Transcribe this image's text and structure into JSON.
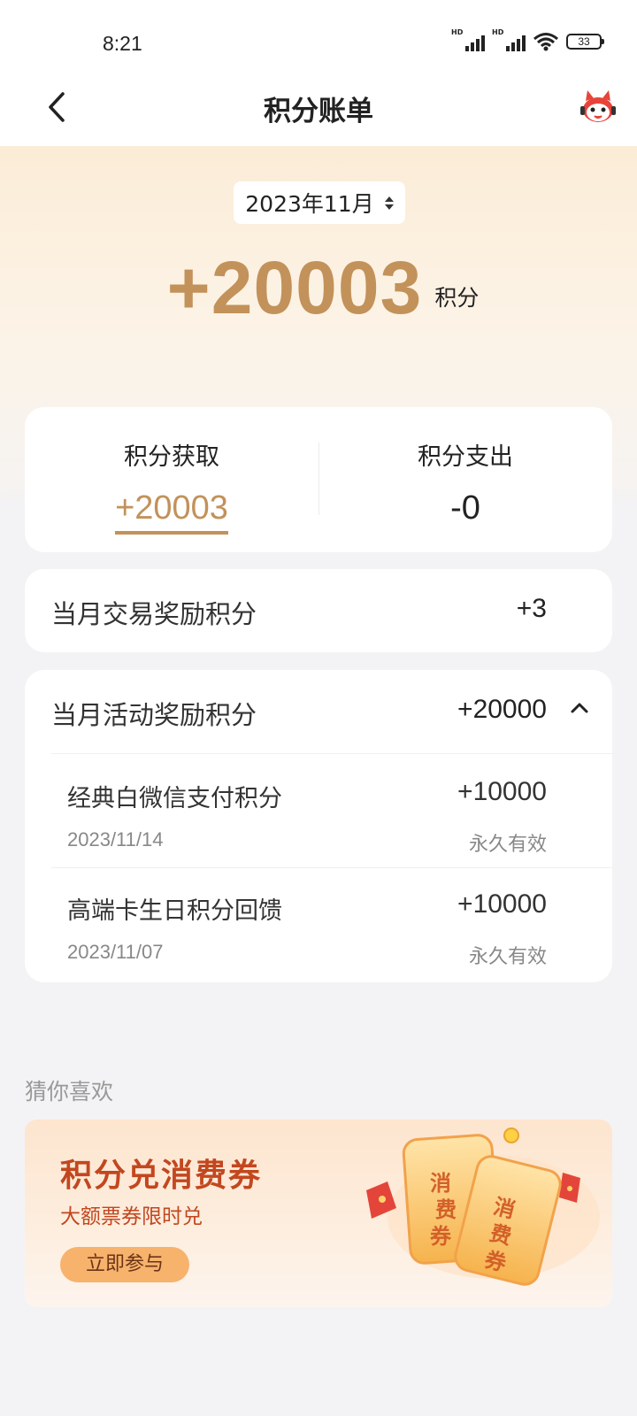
{
  "status": {
    "time": "8:21",
    "battery": "33",
    "signal_label": "HD"
  },
  "nav": {
    "title": "积分账单"
  },
  "header": {
    "month": "2023年11月",
    "total": "+20003",
    "unit": "积分"
  },
  "summary": {
    "earn_label": "积分获取",
    "earn_value": "+20003",
    "spend_label": "积分支出",
    "spend_value": "-0"
  },
  "trade": {
    "label": "当月交易奖励积分",
    "value": "+3"
  },
  "activity": {
    "label": "当月活动奖励积分",
    "value": "+20000",
    "items": [
      {
        "name": "经典白微信支付积分",
        "amount": "+10000",
        "date": "2023/11/14",
        "validity": "永久有效"
      },
      {
        "name": "高端卡生日积分回馈",
        "amount": "+10000",
        "date": "2023/11/07",
        "validity": "永久有效"
      }
    ]
  },
  "recommend": {
    "title": "猜你喜欢",
    "banner": {
      "title": "积分兑消费券",
      "subtitle": "大额票券限时兑",
      "button": "立即参与",
      "coupon_text": "消费券"
    }
  },
  "colors": {
    "accent": "#c2925a",
    "banner_title": "#c2471f",
    "page_bg": "#f3f3f5"
  },
  "icons": [
    "back-arrow-icon",
    "mascot-icon",
    "chevron-up-icon",
    "signal-icon",
    "wifi-icon",
    "battery-icon"
  ]
}
